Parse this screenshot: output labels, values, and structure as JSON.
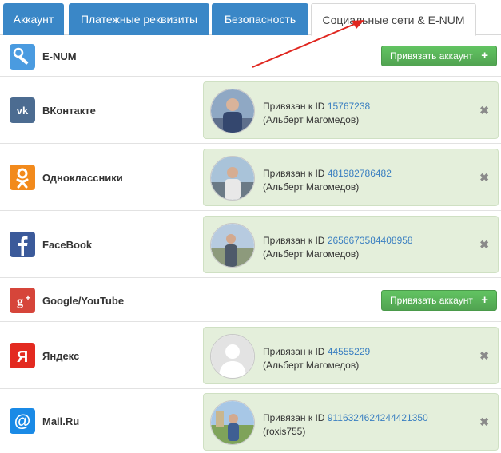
{
  "tabs": [
    {
      "label": "Аккаунт",
      "active": false
    },
    {
      "label": "Платежные реквизиты",
      "active": false
    },
    {
      "label": "Безопасность",
      "active": false
    },
    {
      "label": "Социальные сети & E-NUM",
      "active": true
    }
  ],
  "bind_button_label": "Привязать аккаунт",
  "bind_button_icon": "plus-icon",
  "bound_prefix": "Привязан к ID",
  "remove_icon": "close-icon",
  "networks": [
    {
      "name": "E-NUM",
      "icon": "enum-icon",
      "color": "#3d8fd6",
      "linked": false
    },
    {
      "name": "ВКонтакте",
      "icon": "vk-icon",
      "color": "#4c6c91",
      "linked": true,
      "id": "15767238",
      "user": "(Альберт Магомедов)"
    },
    {
      "name": "Одноклассники",
      "icon": "ok-icon",
      "color": "#f28a1c",
      "linked": true,
      "id": "481982786482",
      "user": "(Альберт Магомедов)"
    },
    {
      "name": "FaceBook",
      "icon": "facebook-icon",
      "color": "#3b5a9a",
      "linked": true,
      "id": "2656673584408958",
      "user": "(Альберт Магомедов)"
    },
    {
      "name": "Google/YouTube",
      "icon": "google-plus-icon",
      "color": "#d6453a",
      "linked": false
    },
    {
      "name": "Яндекс",
      "icon": "yandex-icon",
      "color": "#e32a20",
      "linked": true,
      "id": "44555229",
      "user": "(Альберт Магомедов)"
    },
    {
      "name": "Mail.Ru",
      "icon": "mailru-icon",
      "color": "#1a8ae6",
      "linked": true,
      "id": "9116324624244421350",
      "user": "(roxis755)"
    }
  ]
}
